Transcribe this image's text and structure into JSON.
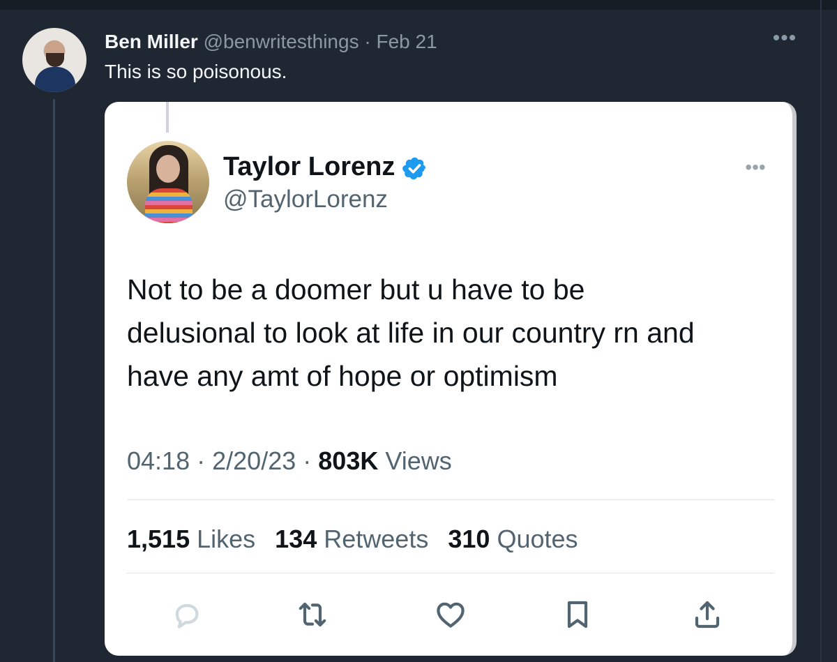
{
  "reply": {
    "author_name": "Ben Miller",
    "handle": "@benwritesthings",
    "separator": "·",
    "date": "Feb 21",
    "text": "This is so poisonous.",
    "more_icon": "more-horizontal-icon"
  },
  "quoted": {
    "author_name": "Taylor Lorenz",
    "handle": "@TaylorLorenz",
    "verified_color": "#1d9bf0",
    "text_lines": [
      "Not to be a doomer but u have to be",
      "delusional to look at life in our country rn and",
      "have any amt of hope or optimism"
    ],
    "time": "04:18",
    "date": "2/20/23",
    "separator": "·",
    "views_count": "803K",
    "views_label": "Views",
    "likes_count": "1,515",
    "likes_label": "Likes",
    "retweets_count": "134",
    "retweets_label": "Retweets",
    "quotes_count": "310",
    "quotes_label": "Quotes",
    "actions": [
      {
        "icon": "reply-icon"
      },
      {
        "icon": "retweet-icon"
      },
      {
        "icon": "like-icon"
      },
      {
        "icon": "bookmark-icon"
      },
      {
        "icon": "share-icon"
      }
    ]
  },
  "colors": {
    "background": "#1f2733",
    "card": "#ffffff",
    "muted_text": "#536471",
    "verified_blue": "#1d9bf0"
  }
}
